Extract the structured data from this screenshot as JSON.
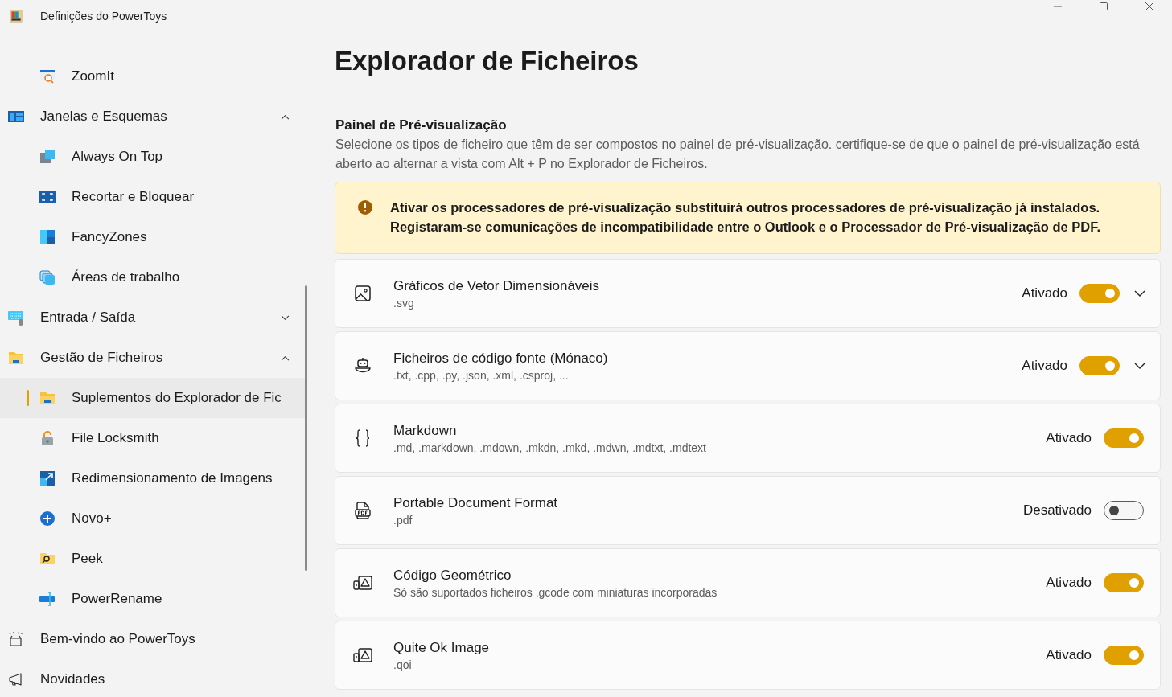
{
  "window": {
    "title": "Definições do PowerToys"
  },
  "sidebar": {
    "items": [
      {
        "children": [
          {
            "label": "ZoomIt",
            "selected": false
          }
        ]
      },
      {
        "label": "Janelas e Esquemas",
        "expanded": true,
        "selected": false,
        "children": [
          {
            "label": "Always On Top",
            "selected": false
          },
          {
            "label": "Recortar e Bloquear",
            "selected": false
          },
          {
            "label": "FancyZones",
            "selected": false
          },
          {
            "label": "Áreas de trabalho",
            "selected": false
          }
        ]
      },
      {
        "label": "Entrada / Saída",
        "expanded": false,
        "selected": false
      },
      {
        "label": "Gestão de Ficheiros",
        "expanded": true,
        "selected": false,
        "children": [
          {
            "label": "Suplementos do Explorador de Fic",
            "selected": true
          },
          {
            "label": "File Locksmith",
            "selected": false
          },
          {
            "label": "Redimensionamento de Imagens",
            "selected": false
          },
          {
            "label": "Novo+",
            "selected": false
          },
          {
            "label": "Peek",
            "selected": false
          },
          {
            "label": "PowerRename",
            "selected": false
          }
        ]
      },
      {
        "label": "Bem-vindo ao PowerToys",
        "selected": false
      },
      {
        "label": "Novidades",
        "selected": false
      }
    ]
  },
  "page": {
    "title": "Explorador de Ficheiros",
    "section": {
      "title": "Painel de Pré-visualização",
      "description": "Selecione os tipos de ficheiro que têm de ser compostos no painel de pré-visualização. certifique-se de que o painel de pré-visualização está aberto ao alternar a vista com Alt + P no Explorador de Ficheiros."
    },
    "warning": {
      "lines": [
        "Ativar os processadores de pré-visualização substituirá outros processadores de pré-visualização já instalados.",
        "Registaram-se comunicações de incompatibilidade entre o Outlook e o Processador de Pré-visualização de PDF."
      ]
    },
    "cards": [
      {
        "title": "Gráficos de Vetor Dimensionáveis",
        "subtitle": ".svg",
        "state_label": "Ativado",
        "on": true,
        "expandable": true
      },
      {
        "title": "Ficheiros de código fonte (Mónaco)",
        "subtitle": ".txt, .cpp, .py, .json, .xml, .csproj, ...",
        "state_label": "Ativado",
        "on": true,
        "expandable": true
      },
      {
        "title": "Markdown",
        "subtitle": ".md, .markdown, .mdown, .mkdn, .mkd, .mdwn, .mdtxt, .mdtext",
        "state_label": "Ativado",
        "on": true,
        "expandable": false
      },
      {
        "title": "Portable Document Format",
        "subtitle": ".pdf",
        "state_label": "Desativado",
        "on": false,
        "expandable": false
      },
      {
        "title": "Código Geométrico",
        "subtitle": "Só são suportados ficheiros .gcode com miniaturas incorporadas",
        "state_label": "Ativado",
        "on": true,
        "expandable": false
      },
      {
        "title": "Quite Ok Image",
        "subtitle": ".qoi",
        "state_label": "Ativado",
        "on": true,
        "expandable": false
      }
    ]
  }
}
